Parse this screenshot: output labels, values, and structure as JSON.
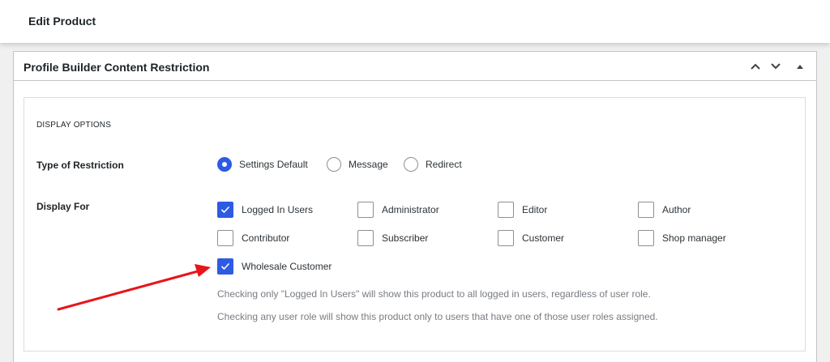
{
  "topbar": {
    "title": "Edit Product"
  },
  "metabox": {
    "title": "Profile Builder Content Restriction",
    "section_title": "DISPLAY OPTIONS",
    "type_label": "Type of Restriction",
    "radios": [
      {
        "label": "Settings Default",
        "checked": true
      },
      {
        "label": "Message",
        "checked": false
      },
      {
        "label": "Redirect",
        "checked": false
      }
    ],
    "display_label": "Display For",
    "checkboxes": [
      {
        "label": "Logged In Users",
        "checked": true
      },
      {
        "label": "Administrator",
        "checked": false
      },
      {
        "label": "Editor",
        "checked": false
      },
      {
        "label": "Author",
        "checked": false
      },
      {
        "label": "Contributor",
        "checked": false
      },
      {
        "label": "Subscriber",
        "checked": false
      },
      {
        "label": "Customer",
        "checked": false
      },
      {
        "label": "Shop manager",
        "checked": false
      },
      {
        "label": "Wholesale Customer",
        "checked": true
      }
    ],
    "help_1": "Checking only \"Logged In Users\" will show this product to all logged in users, regardless of user role.",
    "help_2": "Checking any user role will show this product only to users that have one of those user roles assigned."
  },
  "colors": {
    "accent": "#2d5be3",
    "annotation_arrow": "#e8141b"
  }
}
